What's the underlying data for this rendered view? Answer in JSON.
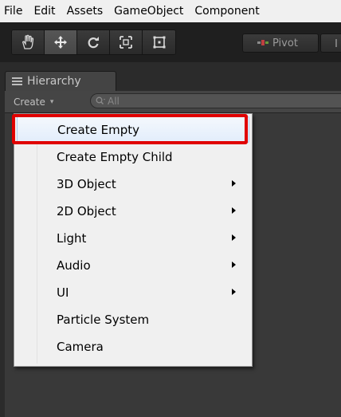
{
  "menubar": {
    "items": [
      "File",
      "Edit",
      "Assets",
      "GameObject",
      "Component"
    ]
  },
  "toolbar": {
    "tools": [
      {
        "icon": "hand-icon",
        "active": false
      },
      {
        "icon": "move-icon",
        "active": true
      },
      {
        "icon": "rotate-icon",
        "active": false
      },
      {
        "icon": "scale-icon",
        "active": false
      },
      {
        "icon": "rect-icon",
        "active": false
      }
    ],
    "pivot_label": "Pivot"
  },
  "hierarchy": {
    "tab_label": "Hierarchy",
    "create_label": "Create",
    "search_placeholder": "All"
  },
  "context_menu": {
    "items": [
      {
        "label": "Create Empty",
        "submenu": false,
        "highlighted": true
      },
      {
        "label": "Create Empty Child",
        "submenu": false,
        "highlighted": false
      },
      {
        "label": "3D Object",
        "submenu": true,
        "highlighted": false
      },
      {
        "label": "2D Object",
        "submenu": true,
        "highlighted": false
      },
      {
        "label": "Light",
        "submenu": true,
        "highlighted": false
      },
      {
        "label": "Audio",
        "submenu": true,
        "highlighted": false
      },
      {
        "label": "UI",
        "submenu": true,
        "highlighted": false
      },
      {
        "label": "Particle System",
        "submenu": false,
        "highlighted": false
      },
      {
        "label": "Camera",
        "submenu": false,
        "highlighted": false
      }
    ]
  },
  "colors": {
    "highlight_outline": "#e00000",
    "panel_bg": "#393939",
    "menu_bg": "#f0f0f0"
  }
}
